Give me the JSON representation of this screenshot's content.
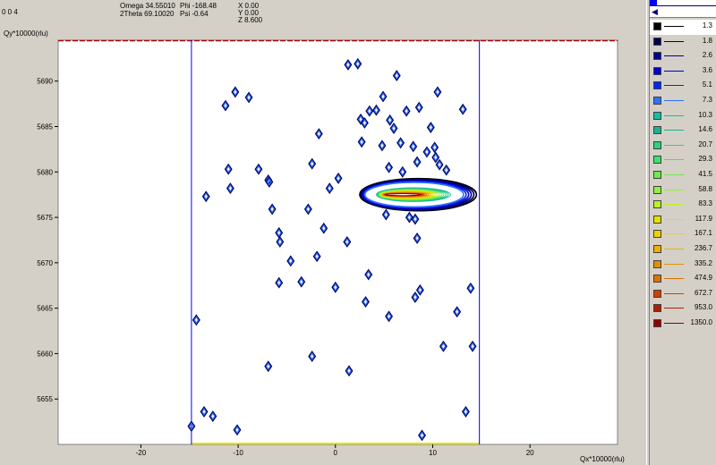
{
  "header": {
    "line1_left": "0 0 4",
    "omega": "Omega 34.55010",
    "twotheta": "2Theta 69.10020",
    "phi": "Phi -168.48",
    "psi": "Psi -0.64",
    "x": "X 0.00",
    "y": "Y 0.00",
    "z": "Z 8.600"
  },
  "colors": {
    "plot_background": "#ffffff",
    "window_background": "#d4d0c8",
    "boundary_lines": "#0000ff"
  },
  "chart_data": {
    "type": "contour",
    "ylabel": "Qy*10000(rlu)",
    "xlabel": "Qx*10000(rlu)",
    "xlim": [
      -28.5,
      29
    ],
    "ylim": [
      5650,
      5694.5
    ],
    "x_ticks": [
      -20,
      -10,
      0,
      10,
      20
    ],
    "y_ticks": [
      5655,
      5660,
      5665,
      5670,
      5675,
      5680,
      5685,
      5690
    ],
    "boundary_qx": [
      -14.8,
      14.8
    ],
    "main_peak": {
      "qx_from": 2.5,
      "qx_to": 14.5,
      "qy": 5677.5,
      "max_level": 1350.0
    },
    "spots": [
      [
        1.3,
        5691.8
      ],
      [
        2.3,
        5691.9
      ],
      [
        6.3,
        5690.6
      ],
      [
        -10.3,
        5688.8
      ],
      [
        -8.9,
        5688.2
      ],
      [
        -11.3,
        5687.3
      ],
      [
        4.9,
        5688.3
      ],
      [
        3.5,
        5686.7
      ],
      [
        4.2,
        5686.8
      ],
      [
        7.3,
        5686.7
      ],
      [
        8.6,
        5687.1
      ],
      [
        10.5,
        5688.8
      ],
      [
        13.1,
        5686.9
      ],
      [
        2.6,
        5685.8
      ],
      [
        3.0,
        5685.4
      ],
      [
        5.6,
        5685.7
      ],
      [
        -1.7,
        5684.2
      ],
      [
        6.0,
        5684.8
      ],
      [
        9.8,
        5684.9
      ],
      [
        2.7,
        5683.3
      ],
      [
        6.7,
        5683.2
      ],
      [
        8.0,
        5682.8
      ],
      [
        9.4,
        5682.2
      ],
      [
        10.3,
        5681.6
      ],
      [
        4.8,
        5682.9
      ],
      [
        8.4,
        5681.1
      ],
      [
        10.2,
        5682.7
      ],
      [
        10.7,
        5680.8
      ],
      [
        11.4,
        5680.2
      ],
      [
        -2.4,
        5680.9
      ],
      [
        -7.9,
        5680.3
      ],
      [
        -11.0,
        5680.3
      ],
      [
        -6.9,
        5679.1
      ],
      [
        -6.8,
        5678.9
      ],
      [
        -10.8,
        5678.2
      ],
      [
        0.3,
        5679.3
      ],
      [
        -0.6,
        5678.2
      ],
      [
        5.5,
        5680.5
      ],
      [
        6.9,
        5680.0
      ],
      [
        -13.3,
        5677.3
      ],
      [
        -6.5,
        5675.9
      ],
      [
        -2.8,
        5675.9
      ],
      [
        5.2,
        5675.3
      ],
      [
        7.6,
        5675.0
      ],
      [
        8.2,
        5674.8
      ],
      [
        -1.2,
        5673.8
      ],
      [
        -5.8,
        5673.3
      ],
      [
        -5.7,
        5672.3
      ],
      [
        1.2,
        5672.3
      ],
      [
        8.4,
        5672.7
      ],
      [
        -1.9,
        5670.7
      ],
      [
        -4.6,
        5670.2
      ],
      [
        -5.8,
        5667.8
      ],
      [
        -3.5,
        5667.9
      ],
      [
        0.0,
        5667.3
      ],
      [
        3.4,
        5668.7
      ],
      [
        8.7,
        5667.0
      ],
      [
        8.2,
        5666.2
      ],
      [
        13.9,
        5667.2
      ],
      [
        -14.3,
        5663.7
      ],
      [
        3.1,
        5665.7
      ],
      [
        5.5,
        5664.1
      ],
      [
        12.5,
        5664.6
      ],
      [
        11.1,
        5660.8
      ],
      [
        14.1,
        5660.8
      ],
      [
        -2.4,
        5659.7
      ],
      [
        -6.9,
        5658.6
      ],
      [
        1.4,
        5658.1
      ],
      [
        -13.5,
        5653.6
      ],
      [
        -12.6,
        5653.1
      ],
      [
        13.4,
        5653.6
      ],
      [
        -14.8,
        5652.0
      ],
      [
        -10.1,
        5651.6
      ],
      [
        8.9,
        5651.0
      ]
    ]
  },
  "legend": {
    "items": [
      {
        "value": "1.3",
        "color": "#000000"
      },
      {
        "value": "1.8",
        "color": "#000050"
      },
      {
        "value": "2.6",
        "color": "#00008c"
      },
      {
        "value": "3.6",
        "color": "#0000c8"
      },
      {
        "value": "5.1",
        "color": "#0028f0"
      },
      {
        "value": "7.3",
        "color": "#3070ff"
      },
      {
        "value": "10.3",
        "color": "#10c0a0"
      },
      {
        "value": "14.6",
        "color": "#20b090"
      },
      {
        "value": "20.7",
        "color": "#30d080"
      },
      {
        "value": "29.3",
        "color": "#40e070"
      },
      {
        "value": "41.5",
        "color": "#70e850"
      },
      {
        "value": "58.8",
        "color": "#90f040"
      },
      {
        "value": "83.3",
        "color": "#c0f020"
      },
      {
        "value": "117.9",
        "color": "#e0e000"
      },
      {
        "value": "167.1",
        "color": "#f0d000"
      },
      {
        "value": "236.7",
        "color": "#f0b000"
      },
      {
        "value": "335.2",
        "color": "#e09000"
      },
      {
        "value": "474.9",
        "color": "#e07000"
      },
      {
        "value": "672.7",
        "color": "#d04000"
      },
      {
        "value": "953.0",
        "color": "#b02000"
      },
      {
        "value": "1350.0",
        "color": "#900000"
      }
    ]
  }
}
